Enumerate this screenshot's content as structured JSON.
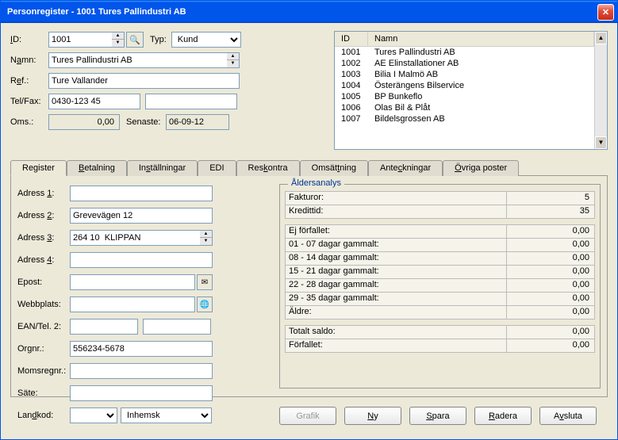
{
  "title": "Personregister - 1001 Tures Pallindustri AB",
  "form": {
    "id_label": "ID:",
    "id_value": "1001",
    "typ_label": "Typ:",
    "typ_value": "Kund",
    "namn_label": "Namn:",
    "namn_value": "Tures Pallindustri AB",
    "ref_label": "Ref.:",
    "ref_value": "Ture Vallander",
    "telfax_label": "Tel/Fax:",
    "tel_value": "0430-123 45",
    "fax_value": "",
    "oms_label": "Oms.:",
    "oms_value": "0,00",
    "senaste_label": "Senaste:",
    "senaste_value": "06-09-12"
  },
  "list": {
    "col_id": "ID",
    "col_namn": "Namn",
    "rows": [
      {
        "id": "1001",
        "namn": "Tures Pallindustri AB"
      },
      {
        "id": "1002",
        "namn": "AE Elinstallationer AB"
      },
      {
        "id": "1003",
        "namn": "Bilia I Malmö AB"
      },
      {
        "id": "1004",
        "namn": "Österängens Bilservice"
      },
      {
        "id": "1005",
        "namn": "BP Bunkeflo"
      },
      {
        "id": "1006",
        "namn": "Olas Bil & Plåt"
      },
      {
        "id": "1007",
        "namn": "Bildelsgrossen AB"
      }
    ]
  },
  "tabs": {
    "register": "Register",
    "betalning": "Betalning",
    "installningar": "Inställningar",
    "edi": "EDI",
    "reskontra": "Reskontra",
    "omsattning": "Omsättning",
    "anteckningar": "Anteckningar",
    "ovriga": "Övriga poster"
  },
  "register": {
    "adress1_label": "Adress 1:",
    "adress1": "",
    "adress2_label": "Adress 2:",
    "adress2": "Grevevägen 12",
    "adress3_label": "Adress 3:",
    "adress3": "264 10  KLIPPAN",
    "adress4_label": "Adress 4:",
    "adress4": "",
    "epost_label": "Epost:",
    "epost": "",
    "webb_label": "Webbplats:",
    "webb": "",
    "ean_label": "EAN/Tel. 2:",
    "ean": "",
    "tel2": "",
    "orgnr_label": "Orgnr.:",
    "orgnr": "556234-5678",
    "momsreg_label": "Momsregnr.:",
    "momsreg": "",
    "sate_label": "Säte:",
    "sate": "",
    "landkod_label": "Landkod:",
    "landkod": "",
    "landtyp": "Inhemsk"
  },
  "analys": {
    "title": "Åldersanalys",
    "fakturor_l": "Fakturor:",
    "fakturor_v": "5",
    "kredit_l": "Kredittid:",
    "kredit_v": "35",
    "ej_l": "Ej förfallet:",
    "ej_v": "0,00",
    "d01_l": "01 - 07 dagar gammalt:",
    "d01_v": "0,00",
    "d08_l": "08 - 14 dagar gammalt:",
    "d08_v": "0,00",
    "d15_l": "15 - 21 dagar gammalt:",
    "d15_v": "0,00",
    "d22_l": "22 - 28 dagar gammalt:",
    "d22_v": "0,00",
    "d29_l": "29 - 35 dagar gammalt:",
    "d29_v": "0,00",
    "aldre_l": "Äldre:",
    "aldre_v": "0,00",
    "totalt_l": "Totalt saldo:",
    "totalt_v": "0,00",
    "forf_l": "Förfallet:",
    "forf_v": "0,00"
  },
  "buttons": {
    "grafik": "Grafik",
    "ny": "Ny",
    "spara": "Spara",
    "radera": "Radera",
    "avsluta": "Avsluta"
  }
}
